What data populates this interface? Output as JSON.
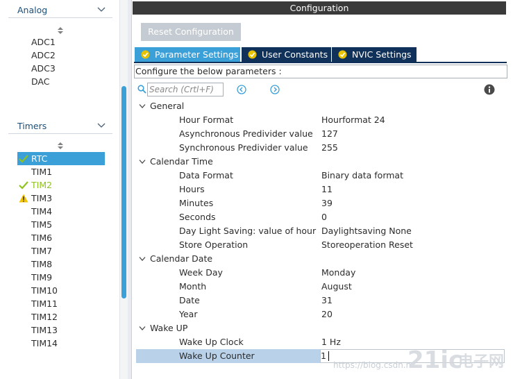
{
  "sidebar": {
    "analog": {
      "label": "Analog",
      "items": [
        "ADC1",
        "ADC2",
        "ADC3",
        "DAC"
      ]
    },
    "timers": {
      "label": "Timers",
      "items": [
        {
          "label": "RTC",
          "status": "ok",
          "selected": true
        },
        {
          "label": "TIM1",
          "status": "none"
        },
        {
          "label": "TIM2",
          "status": "ok"
        },
        {
          "label": "TIM3",
          "status": "warning"
        },
        {
          "label": "TIM4",
          "status": "none"
        },
        {
          "label": "TIM5",
          "status": "none"
        },
        {
          "label": "TIM6",
          "status": "none"
        },
        {
          "label": "TIM7",
          "status": "none"
        },
        {
          "label": "TIM8",
          "status": "none"
        },
        {
          "label": "TIM9",
          "status": "none"
        },
        {
          "label": "TIM10",
          "status": "none"
        },
        {
          "label": "TIM11",
          "status": "none"
        },
        {
          "label": "TIM12",
          "status": "none"
        },
        {
          "label": "TIM13",
          "status": "none"
        },
        {
          "label": "TIM14",
          "status": "none"
        }
      ]
    }
  },
  "config": {
    "title": "Configuration",
    "reset_label": "Reset Configuration",
    "tabs": [
      {
        "label": "Parameter Settings",
        "active": true
      },
      {
        "label": "User Constants",
        "active": false
      },
      {
        "label": "NVIC Settings",
        "active": false
      }
    ],
    "configure_text": "Configure the below parameters :",
    "search_placeholder": "Search (Crtl+F)",
    "groups": [
      {
        "label": "General",
        "params": [
          {
            "name": "Hour Format",
            "value": "Hourformat 24"
          },
          {
            "name": "Asynchronous Predivider value",
            "value": "127"
          },
          {
            "name": "Synchronous Predivider value",
            "value": "255"
          }
        ]
      },
      {
        "label": "Calendar Time",
        "params": [
          {
            "name": "Data Format",
            "value": "Binary data format"
          },
          {
            "name": "Hours",
            "value": "11"
          },
          {
            "name": "Minutes",
            "value": "39"
          },
          {
            "name": "Seconds",
            "value": "0"
          },
          {
            "name": "Day Light Saving: value of hour a...",
            "value": "Daylightsaving None"
          },
          {
            "name": "Store Operation",
            "value": "Storeoperation Reset"
          }
        ]
      },
      {
        "label": "Calendar Date",
        "params": [
          {
            "name": "Week Day",
            "value": "Monday"
          },
          {
            "name": "Month",
            "value": "August"
          },
          {
            "name": "Date",
            "value": "31"
          },
          {
            "name": "Year",
            "value": "20"
          }
        ]
      },
      {
        "label": "Wake UP",
        "params": [
          {
            "name": "Wake Up Clock",
            "value": "1 Hz"
          },
          {
            "name": "Wake Up Counter",
            "value": "1",
            "selected": true
          }
        ]
      }
    ]
  },
  "watermark": "https://blog.csdn.n",
  "logo_text": "21ic电子网",
  "colors": {
    "accent": "#3b9fd8",
    "tab_dark": "#10325a",
    "title_bar": "#3a3a3a",
    "ok_green": "#8fc31f",
    "warning_yellow": "#f5c400"
  }
}
